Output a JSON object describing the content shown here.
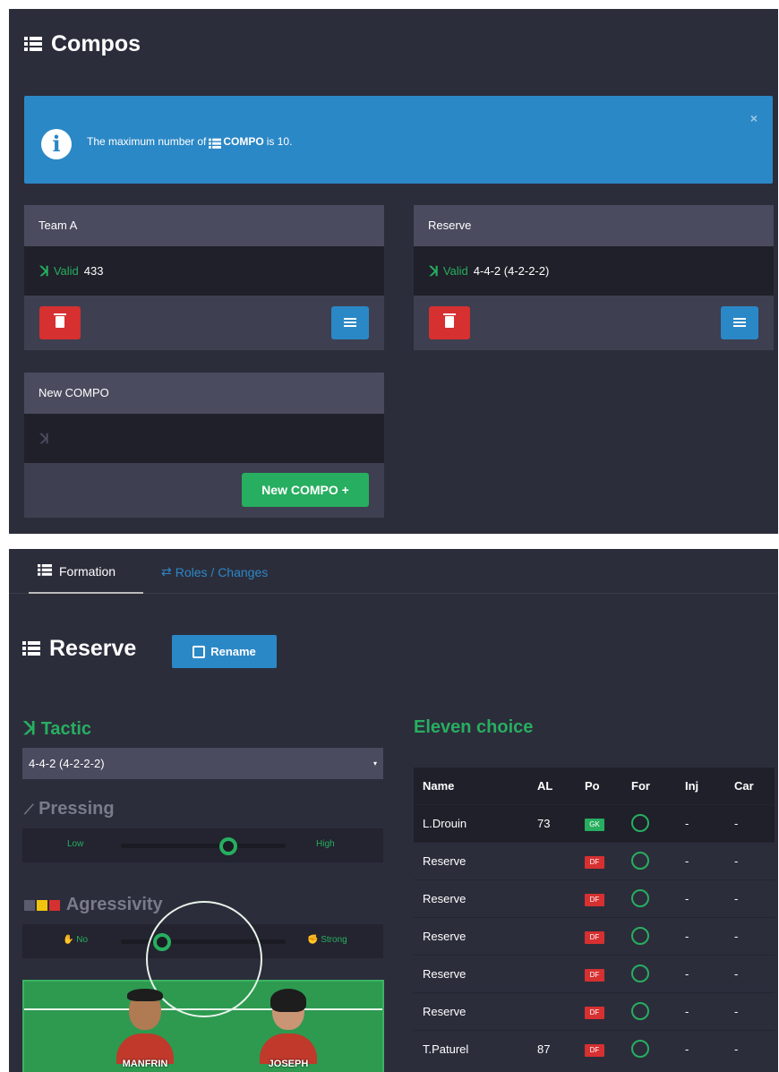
{
  "compos": {
    "title": "Compos",
    "alert": {
      "message_prefix": "The maximum number of",
      "message_bold": "COMPO",
      "message_suffix": "is 10.",
      "close": "×"
    },
    "cards": [
      {
        "name": "Team A",
        "status": "Valid",
        "formation": "433"
      },
      {
        "name": "Reserve",
        "status": "Valid",
        "formation": "4-4-2 (4-2-2-2)"
      },
      {
        "name": "New COMPO",
        "new_button": "New COMPO +"
      }
    ]
  },
  "tabs": {
    "formation": "Formation",
    "roles": "Roles / Changes"
  },
  "compo_detail": {
    "title": "Reserve",
    "rename_label": "Rename",
    "tactic_title": "Tactic",
    "tactic_value": "4-4-2 (4-2-2-2)",
    "caret": "▾",
    "pressing_title": "Pressing",
    "pressing_low": "Low",
    "pressing_high": "High",
    "pressing_level": 0.65,
    "agressivity_title": "Agressivity",
    "agressivity_no": "No",
    "agressivity_strong": "Strong",
    "agressivity_level": 0.25,
    "squad_colors": [
      "#5b5c6e",
      "#f1c40f",
      "#d63031"
    ],
    "players_on_pitch": [
      "MANFRIN",
      "JOSEPH"
    ]
  },
  "eleven": {
    "title": "Eleven choice",
    "columns": [
      "Name",
      "AL",
      "Po",
      "For",
      "Inj",
      "Car"
    ],
    "rows": [
      {
        "name": "L.Drouin",
        "al": "73",
        "po": "GK",
        "inj": "-",
        "car": "-"
      },
      {
        "name": "Reserve",
        "al": "",
        "po": "DF",
        "inj": "-",
        "car": "-"
      },
      {
        "name": "Reserve",
        "al": "",
        "po": "DF",
        "inj": "-",
        "car": "-"
      },
      {
        "name": "Reserve",
        "al": "",
        "po": "DF",
        "inj": "-",
        "car": "-"
      },
      {
        "name": "Reserve",
        "al": "",
        "po": "DF",
        "inj": "-",
        "car": "-"
      },
      {
        "name": "Reserve",
        "al": "",
        "po": "DF",
        "inj": "-",
        "car": "-"
      },
      {
        "name": "T.Paturel",
        "al": "87",
        "po": "DF",
        "inj": "-",
        "car": "-"
      }
    ]
  }
}
